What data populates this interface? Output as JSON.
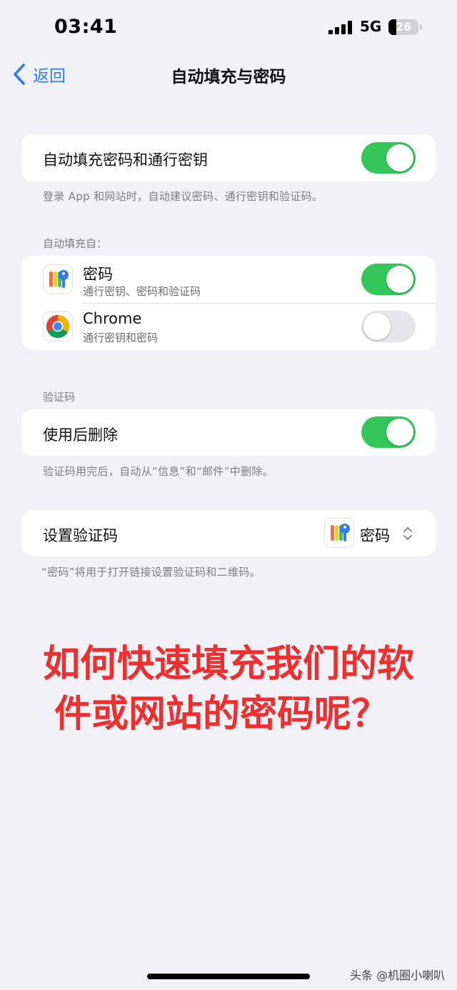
{
  "status_bar": {
    "time": "03:41",
    "network": "5G",
    "battery": "26",
    "battery_level": 0.26
  },
  "nav": {
    "back_label": "返回",
    "title": "自动填充与密码"
  },
  "autofill_group": {
    "label": "自动填充密码和通行密钥",
    "enabled": true,
    "footer": "登录 App 和网站时，自动建议密码、通行密钥和验证码。"
  },
  "autofill_from": {
    "header": "自动填充自：",
    "items": [
      {
        "label": "密码",
        "subtitle": "通行密钥、密码和验证码",
        "icon": "passwords-app-icon",
        "enabled": true
      },
      {
        "label": "Chrome",
        "subtitle": "通行密钥和密码",
        "icon": "chrome-icon",
        "enabled": false
      }
    ]
  },
  "verification": {
    "header": "验证码",
    "delete_after_use_label": "使用后删除",
    "delete_after_use_enabled": true,
    "footer": "验证码用完后，自动从“信息”和“邮件”中删除。"
  },
  "setup_code": {
    "label": "设置验证码",
    "value": "密码",
    "icon": "passwords-app-icon",
    "footer": "“密码”将用于打开链接设置验证码和二维码。"
  },
  "overlay": {
    "line1": "如何快速填充我们的软",
    "line2": "件或网站的密码呢？"
  },
  "watermark": "头条 @机圈小喇叭",
  "colors": {
    "accent": "#2f7cf6",
    "toggle_on": "#33c759",
    "overlay_text": "#ef2f2f",
    "background": "#f1f1f6"
  }
}
